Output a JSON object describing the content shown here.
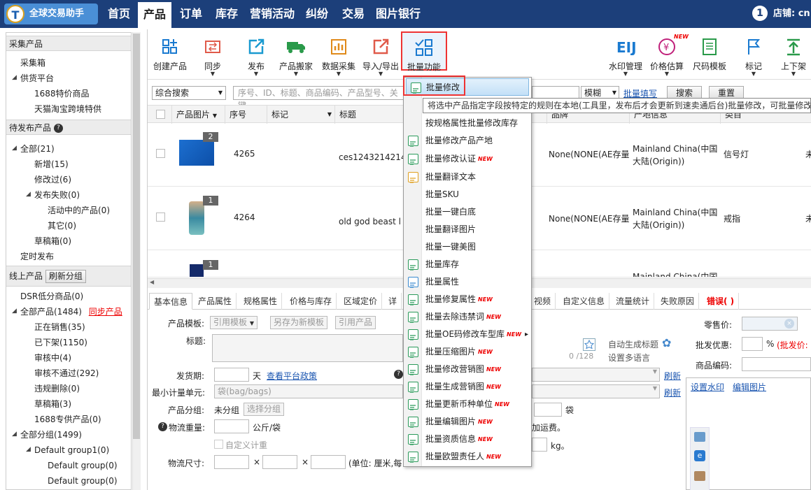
{
  "app": {
    "logo_text": "全球交易助手",
    "logo_letter": "T",
    "notif_count": "1",
    "shop_label": "店铺: cn"
  },
  "nav": [
    "首页",
    "产品",
    "订单",
    "库存",
    "营销活动",
    "纠纷",
    "交易",
    "图片银行"
  ],
  "nav_active": "产品",
  "sidebar": {
    "sec1_title": "采集产品",
    "sec1_items": [
      "采集箱",
      "供货平台",
      "1688特价商品",
      "天猫淘宝跨境特供"
    ],
    "sec2_title": "待发布产品",
    "sec2_items": [
      "全部(21)",
      "新增(15)",
      "修改过(6)",
      "发布失败(0)",
      "活动中的产品(0)",
      "其它(0)",
      "草稿箱(0)",
      "定时发布"
    ],
    "sec3_title": "线上产品",
    "refresh_group_btn": "刷新分组",
    "sec3_items": [
      "DSR低分商品(0)",
      "全部产品(1484)",
      "正在销售(35)",
      "已下架(1150)",
      "审核中(4)",
      "审核不通过(292)",
      "违规删除(0)",
      "草稿箱(3)",
      "1688专供产品(0)",
      "全部分组(1499)",
      "Default group1(0)",
      "Default group(0)",
      "Default group(0)"
    ],
    "sync_link": "同步产品"
  },
  "toolbar": {
    "left": [
      "创建产品",
      "同步",
      "发布",
      "产品搬家",
      "数据采集",
      "导入/导出",
      "批量功能"
    ],
    "right": [
      "水印管理",
      "价格估算",
      "尺码模板",
      "标记",
      "上下架"
    ],
    "new_badge": "NEW"
  },
  "search": {
    "mode": "综合搜索",
    "placeholder": "序号、ID、标题、商品编码、产品型号、关键",
    "match": "模糊",
    "batch_fill": "批量填写",
    "search_btn": "搜索",
    "reset_btn": "重置"
  },
  "table": {
    "headers": [
      "产品图片",
      "序号",
      "标记",
      "标题",
      "品牌",
      "产地信息",
      "类目"
    ],
    "rows": [
      {
        "img_count": "2",
        "seq": "4265",
        "title": "ces12432142141",
        "brand": "None(NONE(AE存量",
        "origin1": "Mainland China(中国",
        "origin2": "大陆(Origin))",
        "category": "信号灯",
        "extra": "未"
      },
      {
        "img_count": "1",
        "seq": "4264",
        "title": "old god beast l",
        "brand": "None(NONE(AE存量",
        "origin1": "Mainland China(中国",
        "origin2": "大陆(Origin))",
        "category": "戒指",
        "extra": "未"
      },
      {
        "img_count": "1",
        "seq": "4263",
        "title": "",
        "brand": "",
        "origin1": "Mainland China(中国",
        "origin2": "",
        "category": "",
        "extra": ""
      }
    ]
  },
  "detail_tabs": [
    "基本信息",
    "产品属性",
    "规格属性",
    "价格与库存",
    "区域定价",
    "详",
    "视频",
    "自定义信息",
    "流量统计",
    "失败原因",
    "错误( )"
  ],
  "form": {
    "template_label": "产品模板:",
    "use_template": "引用模板",
    "save_template": "另存为新模板",
    "ref_product": "引用产品",
    "title_label": "标题:",
    "title_count": "0 /128",
    "auto_title": "自动生成标题",
    "multi_lang": "设置多语言",
    "ship_label": "发货期:",
    "day": "天",
    "policy_link": "查看平台政策",
    "refresh": "刷新",
    "unit_label": "最小计量单元:",
    "unit_value": "袋(bag/bags)",
    "group_label": "产品分组:",
    "group_value": "未分组",
    "group_btn": "选择分组",
    "weight_label": "物流重量:",
    "weight_unit": "公斤/袋",
    "custom_weight": "自定义计重",
    "size_label": "物流尺寸:",
    "size_x": "×",
    "size_unit": "(单位: 厘米,每",
    "retail_label": "零售价:",
    "wholesale_label": "批发优惠:",
    "percent": "%",
    "wholesale_note": "(批发价:",
    "code_label": "商品编码:",
    "bag": "袋",
    "shipping_fee": "加运费。",
    "kg": "kg。",
    "watermark_link": "设置水印",
    "edit_img_link": "编辑图片"
  },
  "dropdown": {
    "items": [
      {
        "label": "批量修改",
        "new": false
      },
      {
        "label": "按规格属性批量修改库存",
        "new": false
      },
      {
        "label": "批量修改产品产地",
        "new": false
      },
      {
        "label": "批量修改认证",
        "new": true
      },
      {
        "label": "批量翻译文本",
        "new": false
      },
      {
        "label": "批量SKU",
        "new": false
      },
      {
        "label": "批量一键白底",
        "new": false
      },
      {
        "label": "批量翻译图片",
        "new": false
      },
      {
        "label": "批量一键美图",
        "new": false
      },
      {
        "label": "批量库存",
        "new": false
      },
      {
        "label": "批量属性",
        "new": false
      },
      {
        "label": "批量修复属性",
        "new": true
      },
      {
        "label": "批量去除违禁词",
        "new": true
      },
      {
        "label": "批量OE码修改车型库",
        "new": true
      },
      {
        "label": "批量压缩图片",
        "new": true
      },
      {
        "label": "批量修改营销图",
        "new": true
      },
      {
        "label": "批量生成营销图",
        "new": true
      },
      {
        "label": "批量更新币种单位",
        "new": true
      },
      {
        "label": "批量编辑图片",
        "new": true
      },
      {
        "label": "批量资质信息",
        "new": true
      },
      {
        "label": "批量欧盟责任人",
        "new": true
      }
    ],
    "tooltip": "将选中产品指定字段按特定的规则在本地(工具里，发布后才会更新到速卖通后台)批量修改，可批量修改"
  }
}
